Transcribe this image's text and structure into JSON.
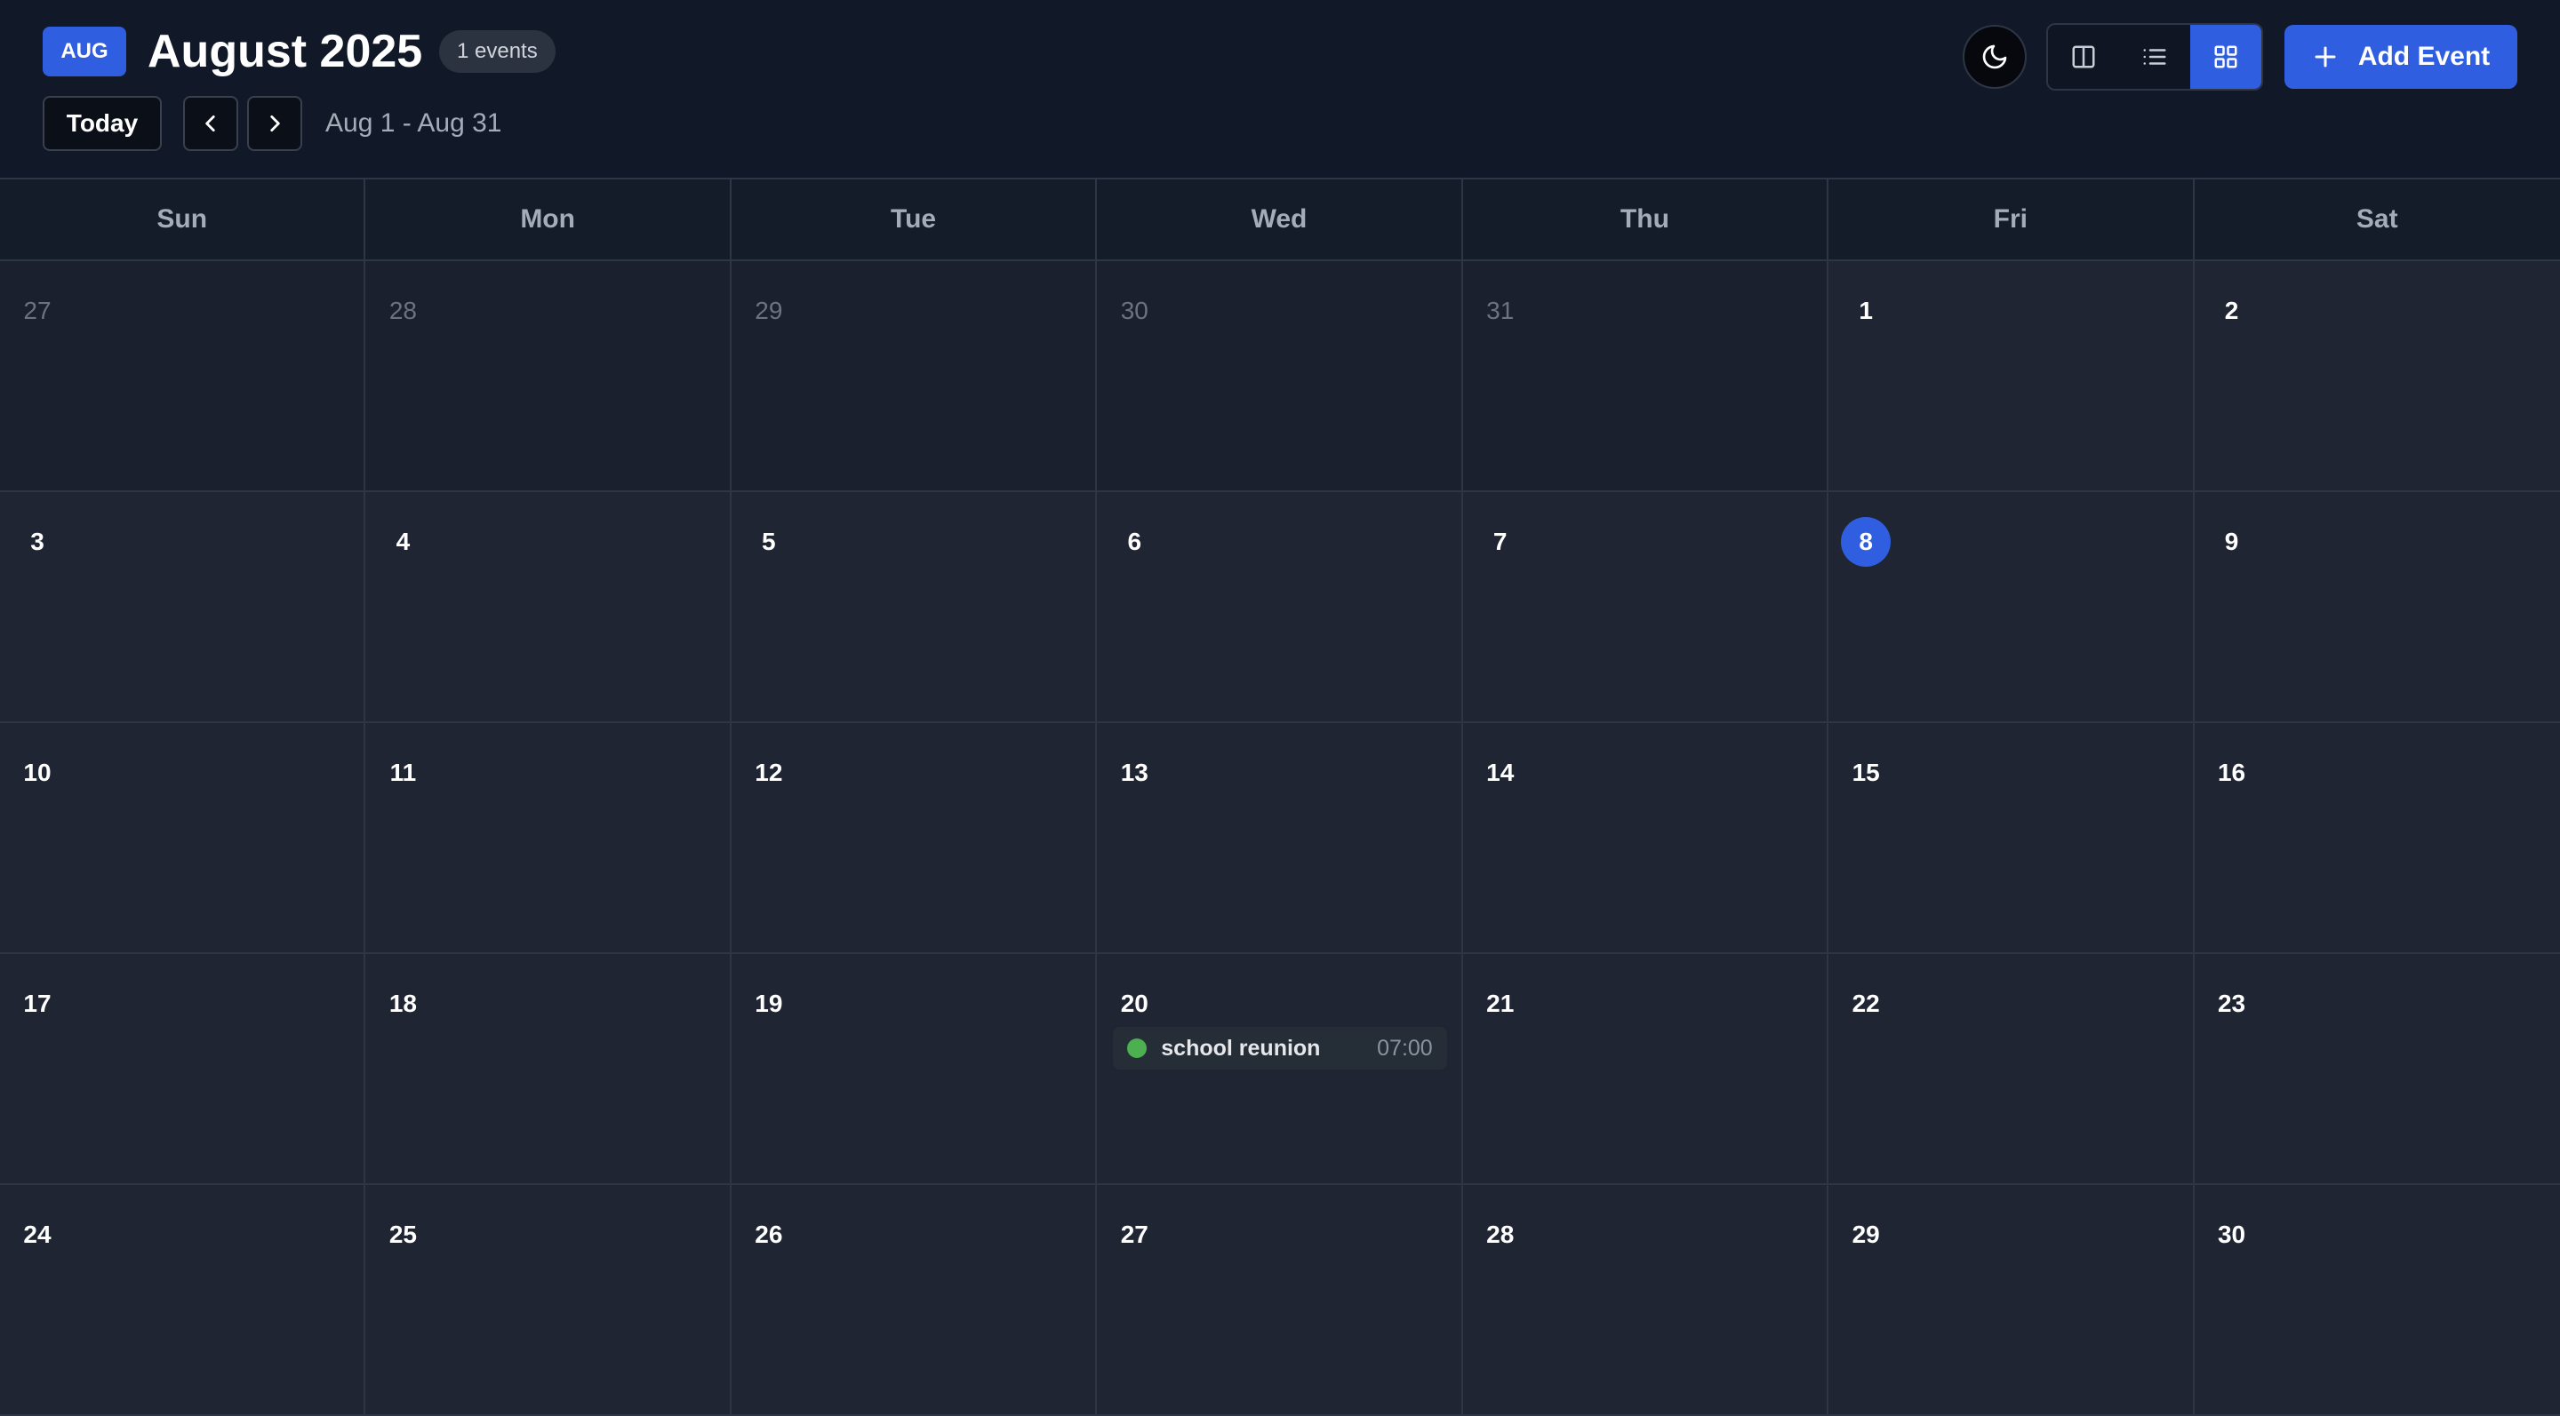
{
  "header": {
    "month_badge": "AUG",
    "title": "August 2025",
    "events_count": "1 events",
    "today_label": "Today",
    "range": "Aug 1 - Aug 31",
    "add_event_label": "Add Event"
  },
  "icons": {
    "theme": "moon-icon",
    "prev": "chevron-left-icon",
    "next": "chevron-right-icon",
    "view_split": "columns-icon",
    "view_list": "list-icon",
    "view_grid": "grid-icon",
    "add": "plus-icon"
  },
  "active_view": "grid",
  "weekdays": [
    "Sun",
    "Mon",
    "Tue",
    "Wed",
    "Thu",
    "Fri",
    "Sat"
  ],
  "days": [
    {
      "label": "27",
      "current_month": false
    },
    {
      "label": "28",
      "current_month": false
    },
    {
      "label": "29",
      "current_month": false
    },
    {
      "label": "30",
      "current_month": false
    },
    {
      "label": "31",
      "current_month": false
    },
    {
      "label": "1",
      "current_month": true
    },
    {
      "label": "2",
      "current_month": true
    },
    {
      "label": "3",
      "current_month": true
    },
    {
      "label": "4",
      "current_month": true
    },
    {
      "label": "5",
      "current_month": true
    },
    {
      "label": "6",
      "current_month": true
    },
    {
      "label": "7",
      "current_month": true
    },
    {
      "label": "8",
      "current_month": true,
      "today": true
    },
    {
      "label": "9",
      "current_month": true
    },
    {
      "label": "10",
      "current_month": true
    },
    {
      "label": "11",
      "current_month": true
    },
    {
      "label": "12",
      "current_month": true
    },
    {
      "label": "13",
      "current_month": true
    },
    {
      "label": "14",
      "current_month": true
    },
    {
      "label": "15",
      "current_month": true
    },
    {
      "label": "16",
      "current_month": true
    },
    {
      "label": "17",
      "current_month": true
    },
    {
      "label": "18",
      "current_month": true
    },
    {
      "label": "19",
      "current_month": true
    },
    {
      "label": "20",
      "current_month": true,
      "events": [
        {
          "title": "school reunion",
          "time": "07:00",
          "color": "#4caf50"
        }
      ]
    },
    {
      "label": "21",
      "current_month": true
    },
    {
      "label": "22",
      "current_month": true
    },
    {
      "label": "23",
      "current_month": true
    },
    {
      "label": "24",
      "current_month": true
    },
    {
      "label": "25",
      "current_month": true
    },
    {
      "label": "26",
      "current_month": true
    },
    {
      "label": "27",
      "current_month": true
    },
    {
      "label": "28",
      "current_month": true
    },
    {
      "label": "29",
      "current_month": true
    },
    {
      "label": "30",
      "current_month": true
    }
  ],
  "colors": {
    "accent": "#2f5fe0",
    "background": "#111827",
    "cell": "#1f2533",
    "border": "#2d3646"
  }
}
